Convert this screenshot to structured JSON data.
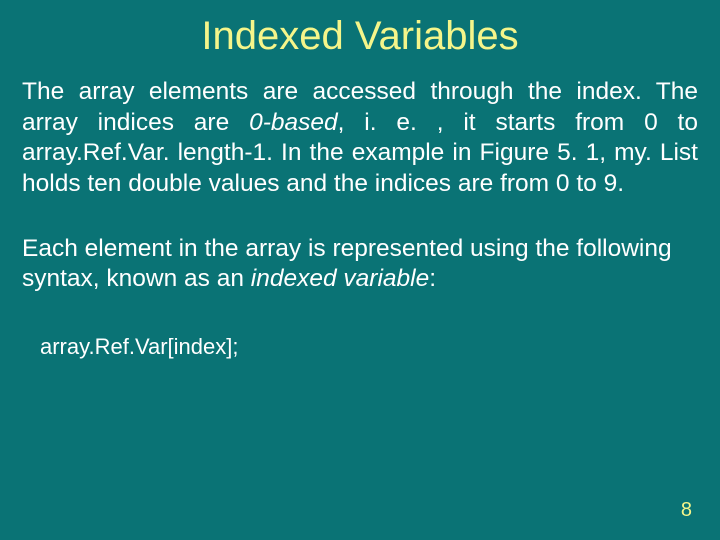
{
  "title": "Indexed Variables",
  "para1_a": "The array elements are accessed through the index. The array indices are ",
  "para1_b": "0-based",
  "para1_c": ", i. e. , it starts from 0 to array.Ref.Var. length-1. In the example in Figure 5. 1, my. List holds ten double values and the indices are from 0 to 9.",
  "para2_a": "Each element in the array is represented using the following syntax, known as an ",
  "para2_b": "indexed variable",
  "para2_c": ":",
  "code": "array.Ref.Var[index];",
  "pagenum": "8"
}
